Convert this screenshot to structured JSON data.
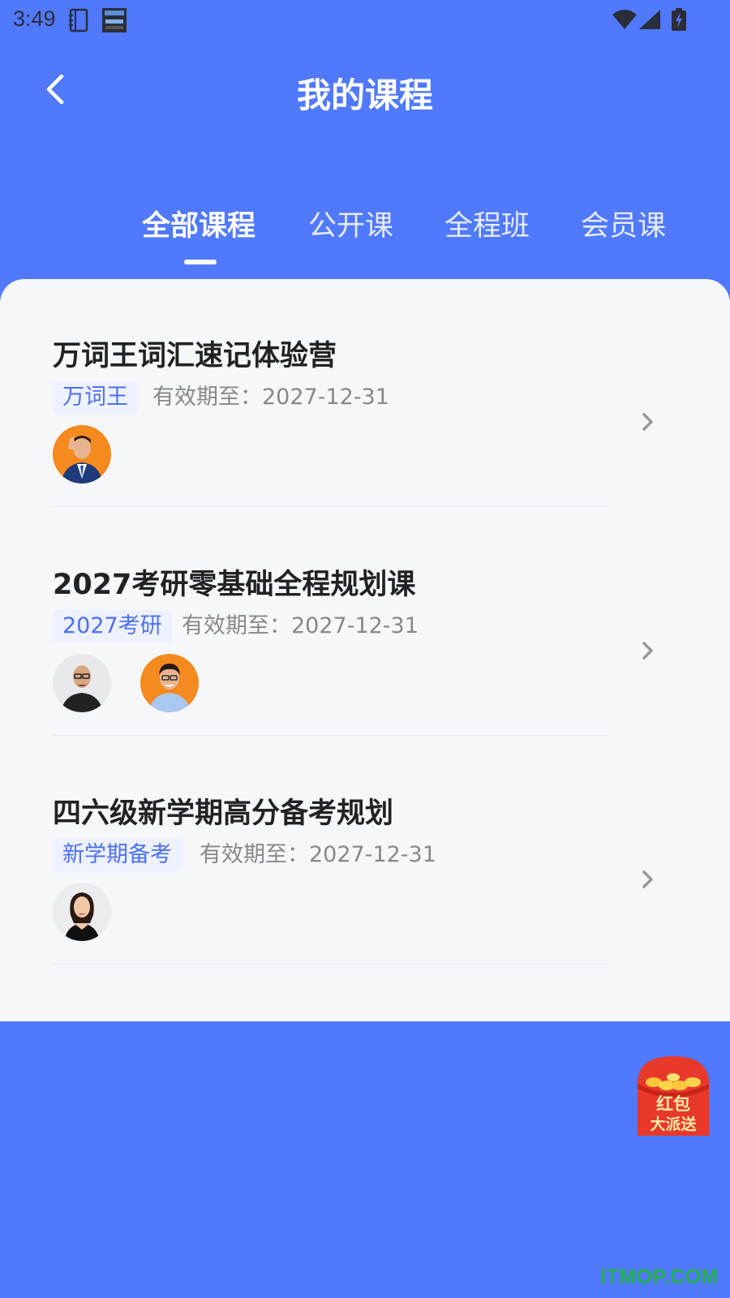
{
  "status_bar": {
    "time": "3:49"
  },
  "header": {
    "title": "我的课程",
    "back_icon": "back-arrow-icon"
  },
  "tabs": [
    {
      "label": "全部课程",
      "active": true
    },
    {
      "label": "公开课",
      "active": false
    },
    {
      "label": "全程班",
      "active": false
    },
    {
      "label": "会员课",
      "active": false
    }
  ],
  "courses": [
    {
      "title": "万词王词汇速记体验营",
      "tag": "万词王",
      "expiry": "有效期至：2027-12-31",
      "teachers": 1
    },
    {
      "title": "2027考研零基础全程规划课",
      "tag": "2027考研",
      "expiry": "有效期至：2027-12-31",
      "teachers": 2
    },
    {
      "title": "四六级新学期高分备考规划",
      "tag": "新学期备考",
      "expiry": "有效期至：2027-12-31",
      "teachers": 1
    }
  ],
  "promo": {
    "line1": "红包",
    "line2": "大派送"
  },
  "watermark": "ITMOP.COM",
  "colors": {
    "primary": "#5079fe",
    "card_bg": "#f6f7fb",
    "tag_text": "#4a70f5",
    "tag_bg": "#eef1ff",
    "red_packet": "#e8382a"
  }
}
